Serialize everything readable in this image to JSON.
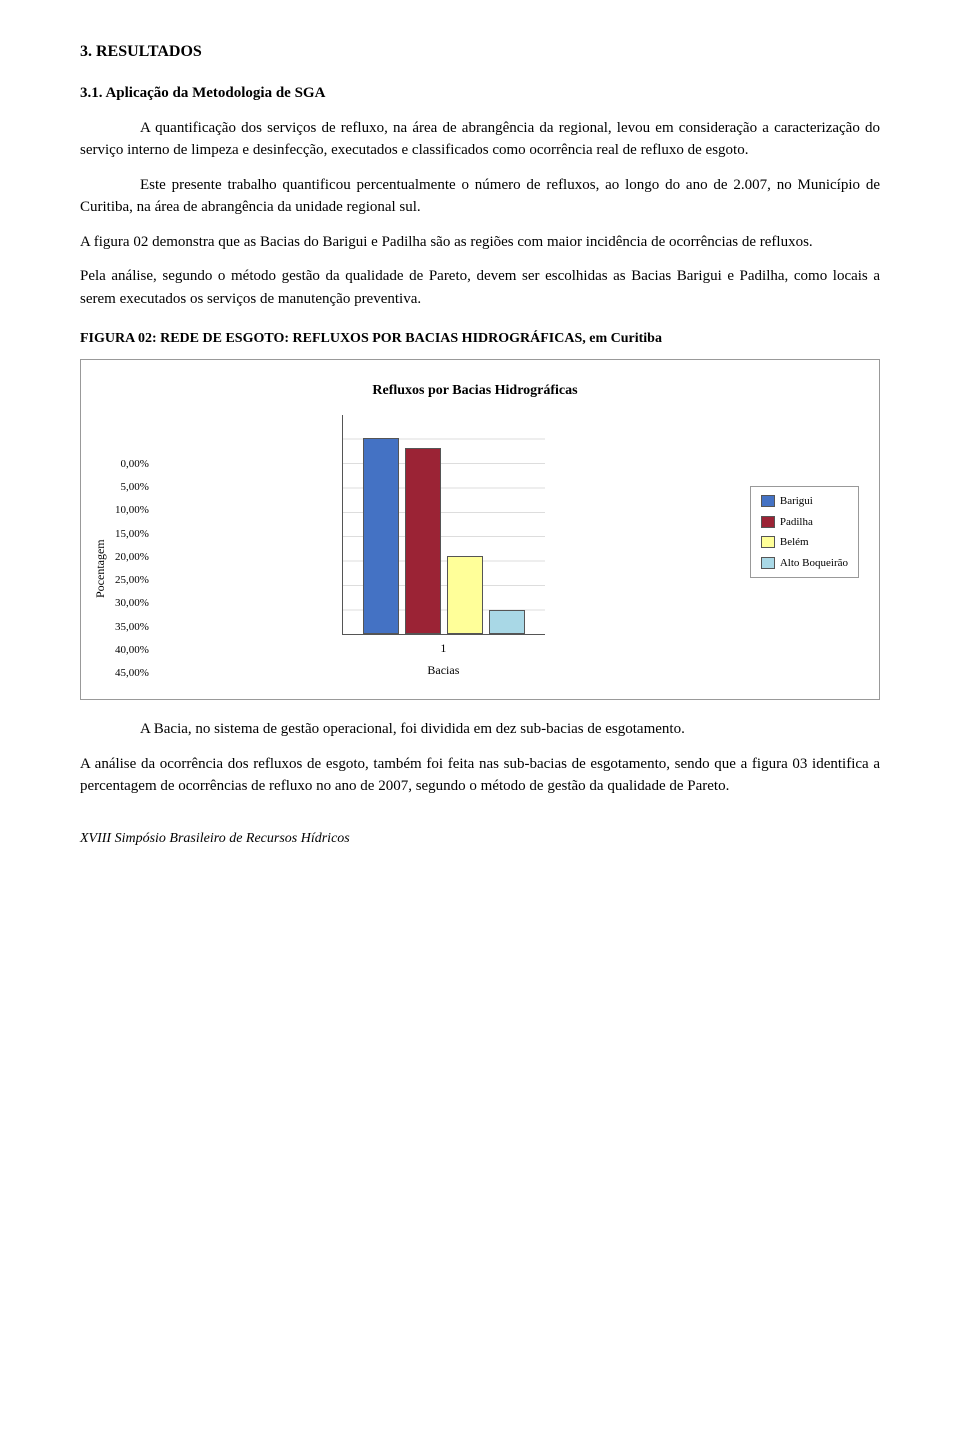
{
  "section": {
    "number": "3.",
    "title": "RESULTADOS"
  },
  "subsection": {
    "number": "3.1.",
    "title": "Aplicação da Metodologia de SGA"
  },
  "paragraphs": {
    "p1": "A quantificação dos serviços de refluxo, na área de abrangência da regional, levou em consideração a caracterização do serviço interno de limpeza e desinfecção, executados e classificados como ocorrência real de refluxo de esgoto.",
    "p2": "Este presente trabalho quantificou percentualmente o número de refluxos, ao longo do ano de 2.007, no Município de Curitiba, na área de abrangência da unidade regional sul.",
    "p3": "A figura 02 demonstra que as Bacias do Barigui e Padilha são as regiões com maior incidência de ocorrências de refluxos.",
    "p4": "Pela análise, segundo o método gestão da qualidade de Pareto, devem ser escolhidas as Bacias Barigui e Padilha, como locais a serem executados os serviços de manutenção preventiva.",
    "p5": "A Bacia, no sistema de gestão operacional, foi dividida em dez sub-bacias de esgotamento.",
    "p6": "A análise da ocorrência dos refluxos de esgoto, também foi feita nas sub-bacias de esgotamento, sendo que a figura 03 identifica a percentagem de ocorrências de refluxo no ano de 2007, segundo o método de gestão da qualidade de Pareto."
  },
  "figure": {
    "caption": "FIGURA 02: REDE DE ESGOTO: REFLUXOS POR BACIAS HIDROGRÁFICAS, em Curitiba",
    "chart_title": "Refluxos por Bacias Hidrográficas",
    "y_axis_label": "Pocentagem",
    "x_axis_label": "Bacias",
    "x_tick": "1",
    "y_ticks": [
      "45,00%",
      "40,00%",
      "35,00%",
      "30,00%",
      "25,00%",
      "20,00%",
      "15,00%",
      "10,00%",
      "5,00%",
      "0,00%"
    ],
    "bars": [
      {
        "label": "Barigui",
        "value": 40,
        "max": 45,
        "color": "#4472C4"
      },
      {
        "label": "Padilha",
        "value": 38,
        "max": 45,
        "color": "#9B2335"
      },
      {
        "label": "Belém",
        "value": 16,
        "max": 45,
        "color": "#FFFF99"
      },
      {
        "label": "Alto Boqueirão",
        "value": 5,
        "max": 45,
        "color": "#A9D8E6"
      }
    ],
    "legend": [
      {
        "label": "Barigui",
        "color": "#4472C4"
      },
      {
        "label": "Padilha",
        "color": "#9B2335"
      },
      {
        "label": "Belém",
        "color": "#FFFF99"
      },
      {
        "label": "Alto Boqueirão",
        "color": "#A9D8E6"
      }
    ]
  },
  "footer": {
    "text": "XVIII Simpósio Brasileiro de Recursos Hídricos"
  }
}
